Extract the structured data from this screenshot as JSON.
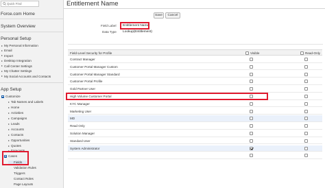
{
  "search": {
    "placeholder": "Quick Find"
  },
  "sidebar": {
    "home_link": "Force.com Home",
    "system_overview": "System Overview",
    "personal_setup": "Personal Setup",
    "personal_items": [
      "My Personal Information",
      "Email",
      "Import",
      "Desktop Integration",
      "Call Center Settings",
      "My Chatter Settings",
      "My Social Accounts and Contacts"
    ],
    "app_setup": "App Setup",
    "customize": "Customize",
    "customize_items": [
      "Tab Names and Labels",
      "Home",
      "Activities",
      "Campaigns",
      "Leads",
      "Accounts",
      "Contacts",
      "Opportunities",
      "Quotes",
      "Forecasts"
    ],
    "cases": "Cases",
    "cases_items": [
      "Fields",
      "Validation Rules",
      "Triggers",
      "Contact Roles",
      "Page Layouts"
    ]
  },
  "main": {
    "title": "Entitlement Name",
    "save_label": "Save",
    "cancel_label": "Cancel",
    "field_label_caption": "Field Label",
    "field_label_value": "Entitlement Name",
    "data_type_caption": "Data Type",
    "data_type_value": "Lookup(Entitlement)"
  },
  "table": {
    "header_label": "Field-Level Security for Profile",
    "header_visible": "Visible",
    "header_readonly": "Read-Only",
    "rows": [
      {
        "label": "Contract Manager",
        "visible": false,
        "read_only": false
      },
      {
        "label": "Customer Portal Manager Custom",
        "visible": false,
        "read_only": false
      },
      {
        "label": "Customer Portal Manager Standard",
        "visible": false,
        "read_only": false
      },
      {
        "label": "Customer Portal Profile",
        "visible": false,
        "read_only": false
      },
      {
        "label": "Gold Partner User",
        "visible": false,
        "read_only": false
      },
      {
        "label": "High Volume Customer Portal",
        "visible": false,
        "read_only": false
      },
      {
        "label": "KYC Manager",
        "visible": false,
        "read_only": false
      },
      {
        "label": "Marketing User",
        "visible": false,
        "read_only": false
      },
      {
        "label": "MD",
        "visible": false,
        "read_only": false
      },
      {
        "label": "Read Only",
        "visible": false,
        "read_only": false
      },
      {
        "label": "Solution Manager",
        "visible": false,
        "read_only": false
      },
      {
        "label": "Standard User",
        "visible": false,
        "read_only": false
      },
      {
        "label": "System Administrator",
        "visible": true,
        "read_only": false
      },
      {
        "label": "",
        "visible": false,
        "read_only": false
      }
    ]
  },
  "colors": {
    "highlight": "#e0192e",
    "accent": "#1b5faa",
    "row_alt": "#eaf1fb"
  }
}
